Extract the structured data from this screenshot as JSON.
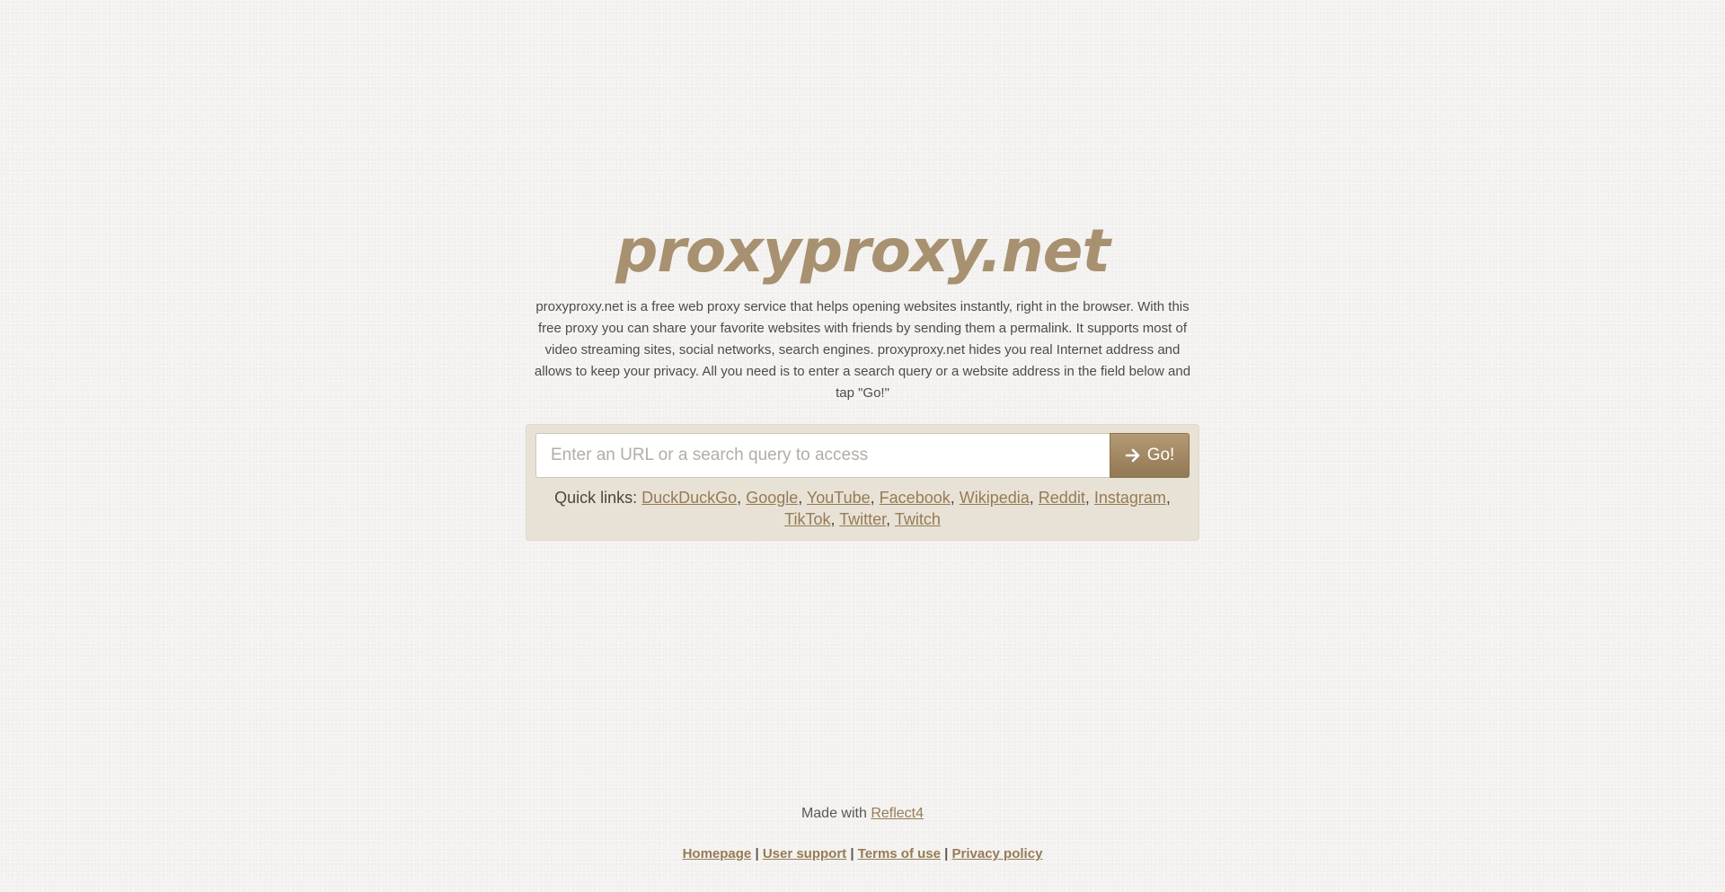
{
  "header": {
    "logo": "proxyproxy.net"
  },
  "intro": {
    "description": "proxyproxy.net is a free web proxy service that helps opening websites instantly, right in the browser. With this free proxy you can share your favorite websites with friends by sending them a permalink. It supports most of video streaming sites, social networks, search engines. proxyproxy.net hides you real Internet address and allows to keep your privacy. All you need is to enter a search query or a website address in the field below and tap \"Go!\""
  },
  "search": {
    "value": "",
    "placeholder": "Enter an URL or a search query to access",
    "button_label": "Go!",
    "button_icon": "arrow-right-icon"
  },
  "quick_links": {
    "label": "Quick links:",
    "items": [
      "DuckDuckGo",
      "Google",
      "YouTube",
      "Facebook",
      "Wikipedia",
      "Reddit",
      "Instagram",
      "TikTok",
      "Twitter",
      "Twitch"
    ]
  },
  "footer": {
    "made_with_label": "Made with",
    "made_with_link": "Reflect4",
    "links": [
      "Homepage",
      "User support",
      "Terms of use",
      "Privacy policy"
    ],
    "separator": "|"
  },
  "colors": {
    "logo": "#a89170",
    "link": "#957b55",
    "panel": "#e8e2d6",
    "button": "#a38a66"
  }
}
